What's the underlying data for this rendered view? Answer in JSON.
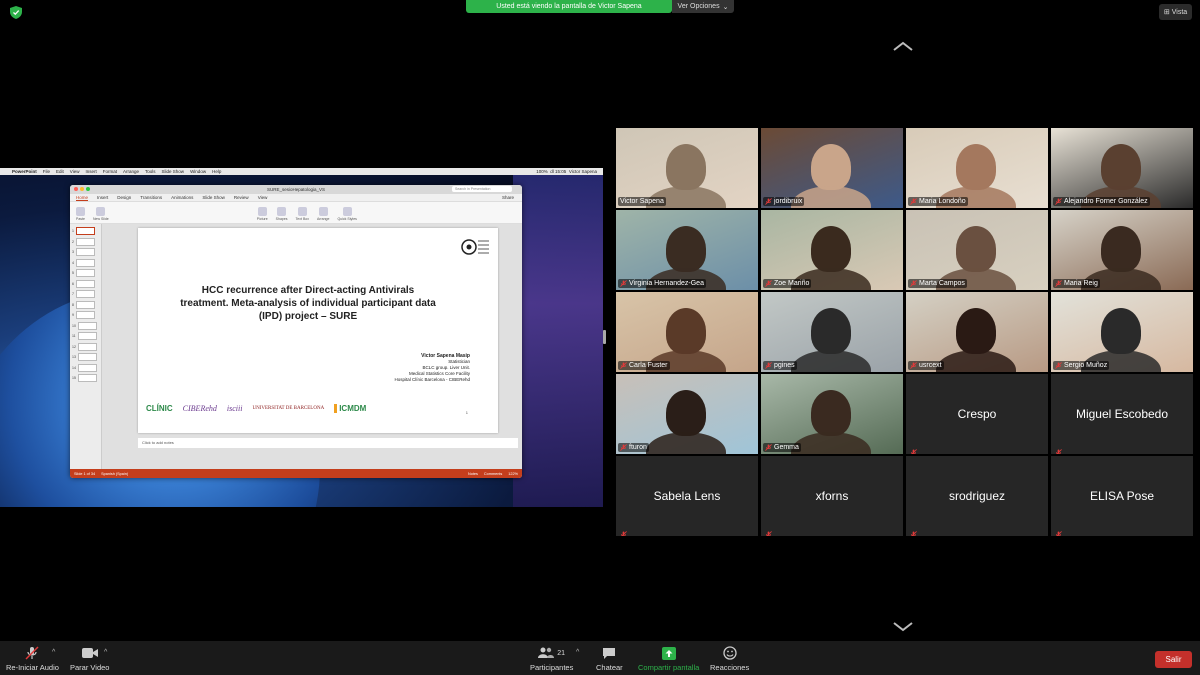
{
  "banner": {
    "sharing_text": "Usted está viendo la pantalla de Victor Sapena",
    "view_options": "Ver Opciones",
    "view_button": "Vista"
  },
  "shared_screen": {
    "menubar": {
      "app": "PowerPoint",
      "menus": [
        "File",
        "Edit",
        "View",
        "Insert",
        "Format",
        "Arrange",
        "Tools",
        "Slide Show",
        "Window",
        "Help"
      ],
      "clock": "dl 15:05",
      "user": "Victor Sapena",
      "battery": "100%"
    },
    "window_title": "SURE_sesioHepatologia_VS",
    "search_placeholder": "Search in Presentation",
    "tabs": [
      "Home",
      "Insert",
      "Design",
      "Transitions",
      "Animations",
      "Slide Show",
      "Review",
      "View"
    ],
    "share_label": "Share",
    "ribbon": [
      "Paste",
      "New Slide",
      "Picture",
      "Shapes",
      "Text Box",
      "Arrange",
      "Quick Styles"
    ],
    "slide_numbers": [
      "1",
      "2",
      "3",
      "4",
      "5",
      "6",
      "7",
      "8",
      "9",
      "10",
      "11",
      "12",
      "13",
      "14",
      "15"
    ],
    "slide": {
      "title": "HCC recurrence after Direct-acting Antivirals treatment. Meta-analysis of individual participant data (IPD) project – SURE",
      "author_name": "Victor Sapena Masip",
      "author_lines": [
        "Statistician",
        "BCLC group. Liver Unit.",
        "Medical Statistics Core Facility",
        "Hospital Clínic Barcelona - CIBERehd"
      ],
      "page": "1",
      "logos": [
        "CLÍNIC",
        "CIBERehd",
        "isciii",
        "UNIVERSITAT DE BARCELONA",
        "ICMDM"
      ]
    },
    "notes_placeholder": "Click to add notes",
    "status": {
      "slide_info": "Slide 1 of 34",
      "language": "Spanish (Spain)",
      "notes": "Notes",
      "comments": "Comments",
      "zoom": "122%"
    }
  },
  "gallery": {
    "participants": [
      {
        "name": "Victor Sapena",
        "muted": false,
        "video": true,
        "active": false
      },
      {
        "name": "jordibruix",
        "muted": true,
        "video": true,
        "active": false
      },
      {
        "name": "Maria Londoño",
        "muted": true,
        "video": true,
        "active": false
      },
      {
        "name": "Alejandro Forner González",
        "muted": true,
        "video": true,
        "active": true
      },
      {
        "name": "Virginia Hernandez-Gea",
        "muted": true,
        "video": true,
        "active": false
      },
      {
        "name": "Zoe Mariño",
        "muted": true,
        "video": true,
        "active": false
      },
      {
        "name": "Marta Campos",
        "muted": true,
        "video": true,
        "active": false
      },
      {
        "name": "Maria Reig",
        "muted": true,
        "video": true,
        "active": false
      },
      {
        "name": "Carla Fuster",
        "muted": true,
        "video": true,
        "active": false
      },
      {
        "name": "pgines",
        "muted": true,
        "video": true,
        "active": false
      },
      {
        "name": "usrcext",
        "muted": true,
        "video": true,
        "active": false
      },
      {
        "name": "Sergio Muñoz",
        "muted": true,
        "video": true,
        "active": false
      },
      {
        "name": "fturon",
        "muted": true,
        "video": true,
        "active": false
      },
      {
        "name": "Gemma",
        "muted": true,
        "video": true,
        "active": false
      },
      {
        "name": "Crespo",
        "muted": true,
        "video": false,
        "active": false
      },
      {
        "name": "Miguel Escobedo",
        "muted": true,
        "video": false,
        "active": false
      },
      {
        "name": "Sabela Lens",
        "muted": true,
        "video": false,
        "active": false
      },
      {
        "name": "xforns",
        "muted": true,
        "video": false,
        "active": false
      },
      {
        "name": "srodriguez",
        "muted": true,
        "video": false,
        "active": false
      },
      {
        "name": "ELISA Pose",
        "muted": true,
        "video": false,
        "active": false
      }
    ]
  },
  "toolbar": {
    "audio_label": "Re-Iniciar Audio",
    "video_label": "Parar Video",
    "participants_label": "Participantes",
    "participants_count": "21",
    "chat_label": "Chatear",
    "share_label": "Compartir pantalla",
    "reactions_label": "Reacciones",
    "leave_label": "Salir"
  },
  "colors": {
    "share_banner": "#2db24a",
    "share_button": "#2db24a",
    "leave_button": "#c4302b",
    "active_speaker": "#d6e05a",
    "ppt_accent": "#c43e1c"
  }
}
